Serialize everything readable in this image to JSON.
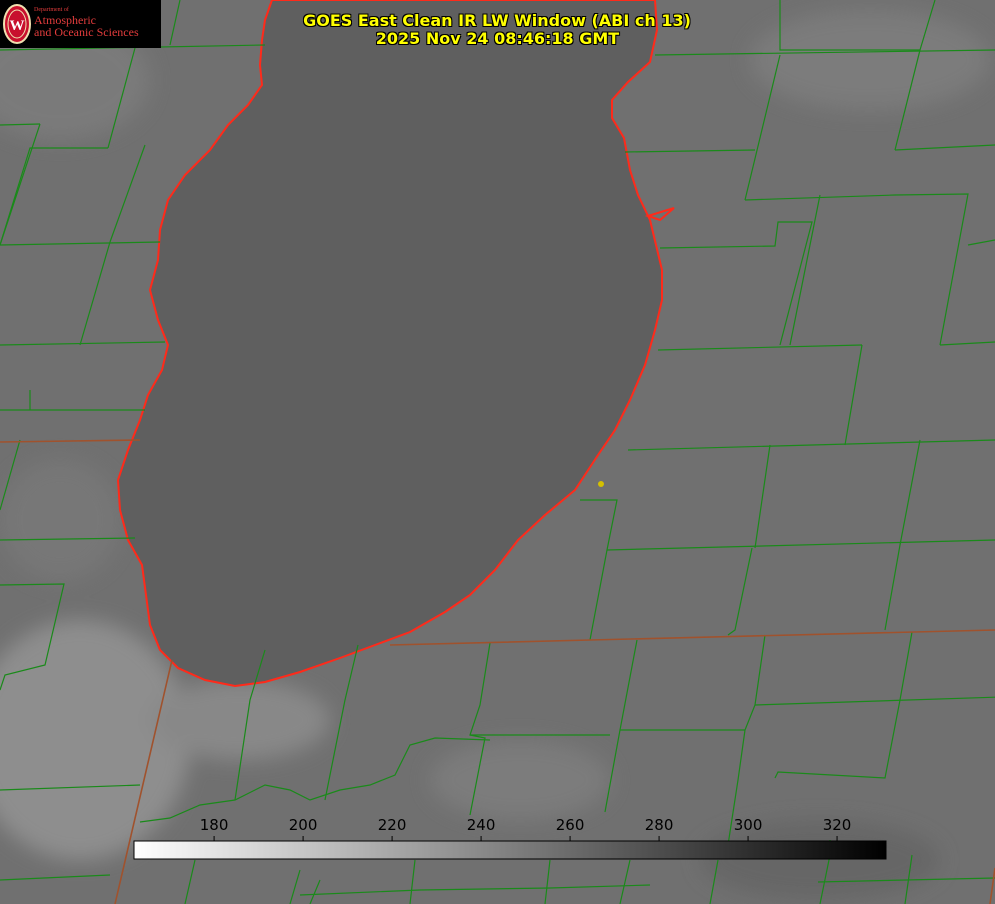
{
  "header": {
    "title_line1": "GOES East Clean IR LW Window (ABI ch 13)",
    "title_line2": "2025 Nov 24 08:46:18 GMT"
  },
  "logo": {
    "dept": "Department of",
    "line1": "Atmospheric",
    "line2": "and Oceanic Sciences",
    "seal_letter": "W"
  },
  "colorbar": {
    "ticks": [
      "180",
      "200",
      "220",
      "240",
      "260",
      "280",
      "300",
      "320"
    ],
    "tick_values": [
      180,
      200,
      220,
      240,
      260,
      280,
      300,
      320
    ],
    "range": [
      162,
      331
    ],
    "start_color": "#ffffff",
    "end_color": "#000000"
  },
  "colors": {
    "title": "#ffff00",
    "coastline": "#ff2a1a",
    "county_lines": "#1a8a1a",
    "state_lines": "#a0522d",
    "lake": "#5f5f5f",
    "land": "#727272",
    "marker": "#d4c000"
  }
}
